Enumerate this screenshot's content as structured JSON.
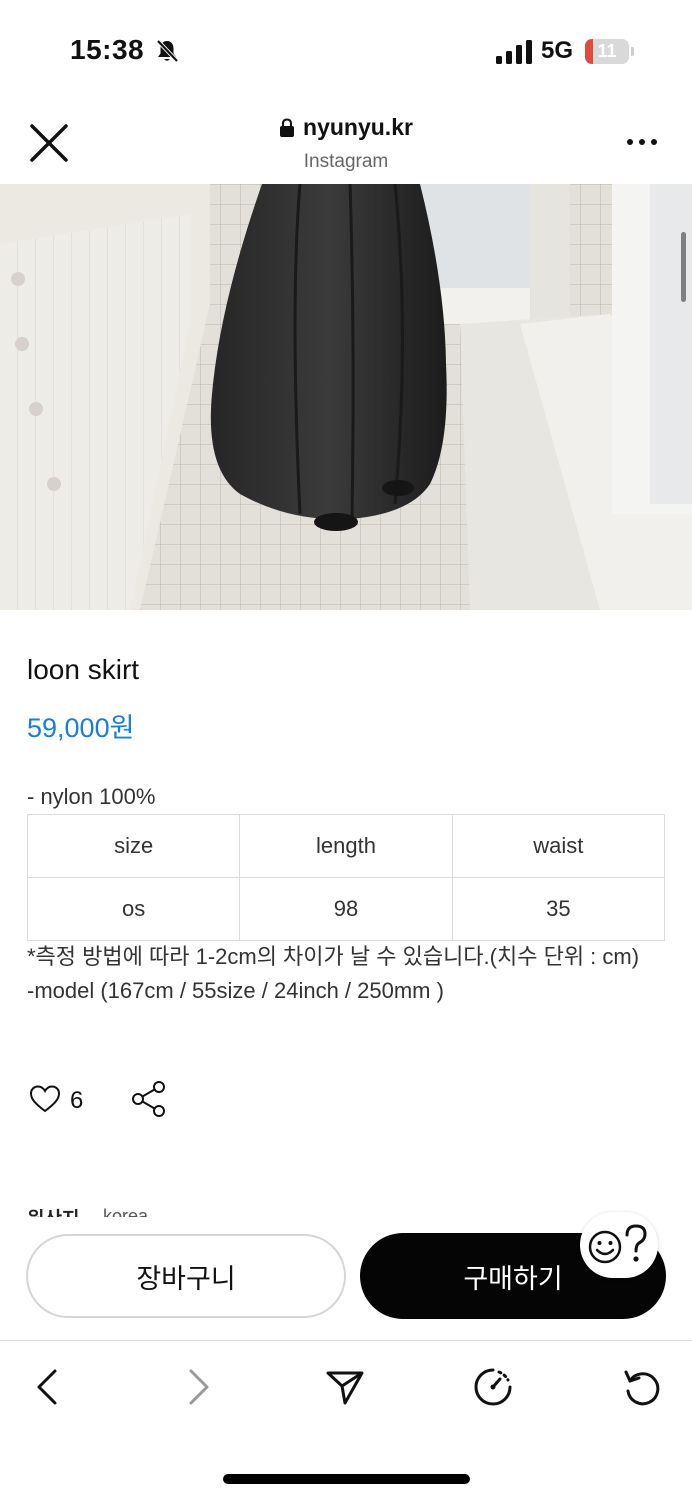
{
  "status_bar": {
    "time": "15:38",
    "network": "5G",
    "battery_level": "11",
    "icons": [
      "bell-slash-icon",
      "signal-icon",
      "battery-icon"
    ],
    "battery_color": "#e04b3c"
  },
  "browser": {
    "url": "nyunyu.kr",
    "subtitle": "Instagram",
    "icons": [
      "close-icon",
      "lock-icon",
      "more-icon"
    ]
  },
  "product": {
    "image_icon": "product-photo-black-balloon-skirt",
    "title": "loon skirt",
    "price": "59,000원",
    "price_color": "#1a7fd4",
    "material": "- nylon 100%",
    "size_table": {
      "headers": [
        "size",
        "length",
        "waist"
      ],
      "rows": [
        [
          "os",
          "98",
          "35"
        ]
      ]
    },
    "note_line1": "*측정 방법에 따라 1-2cm의 차이가 날 수 있습니다.(치수 단위 : cm)",
    "note_line2": "-model  (167cm / 55size / 24inch / 250mm )",
    "likes": "6",
    "origin_label": "원산지",
    "origin_value": "korea"
  },
  "purchase_bar": {
    "cart_label": "장바구니",
    "buy_label": "구매하기",
    "help_icon": "smiley-question-icon"
  },
  "toolbar": {
    "icons": [
      "back-icon",
      "forward-icon",
      "send-icon",
      "speed-icon",
      "reload-icon"
    ]
  }
}
